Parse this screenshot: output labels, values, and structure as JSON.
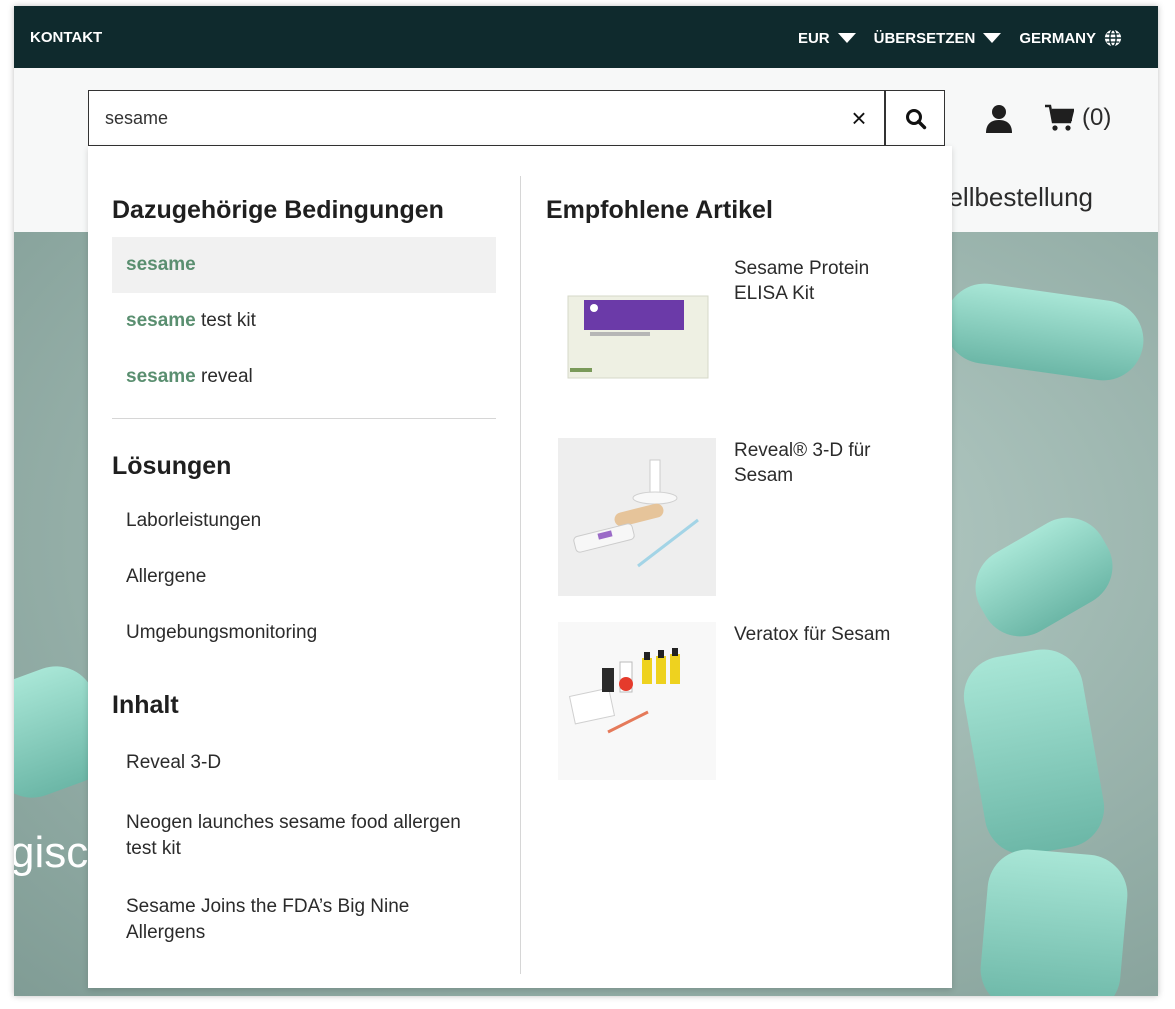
{
  "topbar": {
    "contact": "KONTAKT",
    "currency": "EUR",
    "translate": "ÜBERSETZEN",
    "region": "GERMANY"
  },
  "search": {
    "value": "sesame",
    "placeholder": "",
    "clear_label": "×"
  },
  "cart": {
    "count": "(0)"
  },
  "nav_partial": "nellbestellung",
  "hero_partial": "gisc",
  "dropdown": {
    "related_heading": "Dazugehörige Bedingungen",
    "related_terms": [
      {
        "match": "sesame",
        "rest": ""
      },
      {
        "match": "sesame",
        "rest": " test kit"
      },
      {
        "match": "sesame",
        "rest": " reveal"
      }
    ],
    "solutions_heading": "Lösungen",
    "solutions": [
      "Laborleistungen",
      "Allergene",
      "Umgebungsmonitoring"
    ],
    "content_heading": "Inhalt",
    "content": [
      "Reveal 3-D",
      "Neogen launches sesame food allergen test kit",
      "Sesame Joins the FDA’s Big Nine Allergens"
    ],
    "featured_heading": "Empfohlene Artikel",
    "products": [
      {
        "title": "Sesame Protein ELISA Kit"
      },
      {
        "title": "Reveal® 3-D für Sesam"
      },
      {
        "title": "Veratox für Sesam"
      }
    ]
  },
  "colors": {
    "topbar_bg": "#0f2a2d",
    "match_green": "#5a8f70",
    "highlight_bg": "#f1f1f1"
  },
  "icons": [
    "chevron-down-icon",
    "globe-icon",
    "close-icon",
    "search-icon",
    "user-icon",
    "cart-icon"
  ]
}
